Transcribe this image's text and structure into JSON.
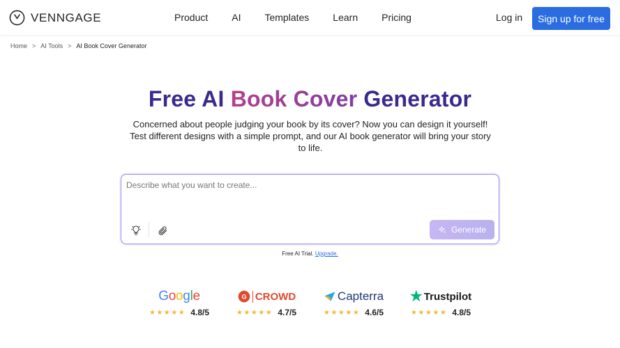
{
  "header": {
    "logo_text": "VENNGAGE",
    "nav": [
      "Product",
      "AI",
      "Templates",
      "Learn",
      "Pricing"
    ],
    "login": "Log in",
    "signup": "Sign up for free"
  },
  "breadcrumb": {
    "items": [
      "Home",
      "AI Tools"
    ],
    "separator": ">",
    "current": "AI Book Cover Generator"
  },
  "hero": {
    "title_part1": "Free AI ",
    "title_highlight": "Book Cover",
    "title_part2": " Generator",
    "subtitle": "Concerned about people judging your book by its cover? Now you can design it yourself! Test different designs with a simple prompt, and our AI book generator will bring your story to life."
  },
  "prompt": {
    "placeholder": "Describe what you want to create...",
    "value": "",
    "tools": [
      "lightbulb-icon",
      "paperclip-icon"
    ],
    "generate_label": "Generate"
  },
  "trial": {
    "text": "Free AI Trial. ",
    "link": "Upgrade."
  },
  "ratings": [
    {
      "brand": "Google",
      "stars": "★★★★★",
      "score": "4.8/5"
    },
    {
      "brand": "CROWD",
      "stars": "★★★★★",
      "score": "4.7/5"
    },
    {
      "brand": "Capterra",
      "stars": "★★★★★",
      "score": "4.6/5"
    },
    {
      "brand": "Trustpilot",
      "stars": "★★★★★",
      "score": "4.8/5"
    }
  ],
  "colors": {
    "accent": "#2b6de0",
    "title": "#3a2a8c",
    "highlight": "#b4408a",
    "star": "#f4b63a"
  }
}
